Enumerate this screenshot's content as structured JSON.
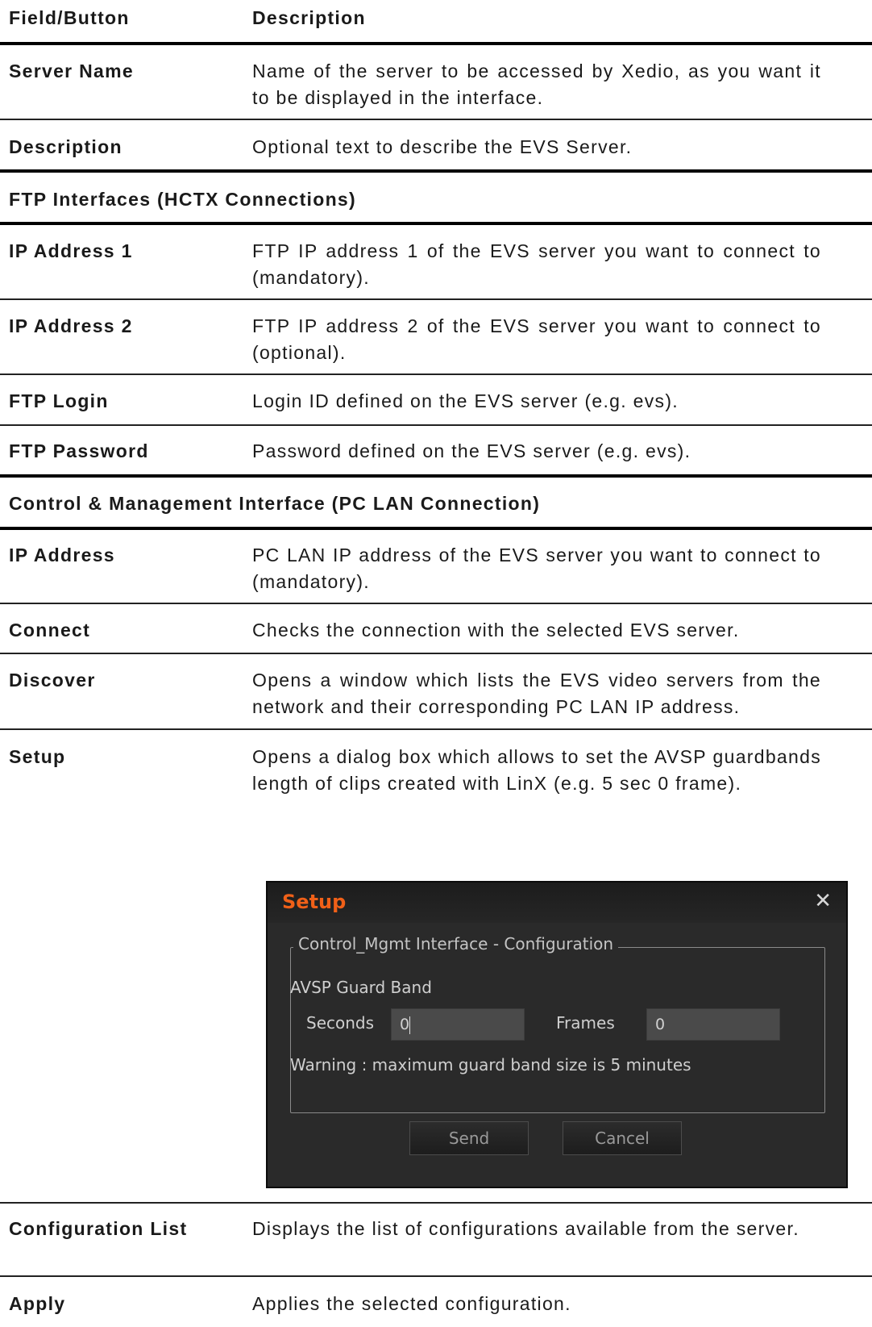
{
  "header": {
    "col1": "Field/Button",
    "col2": "Description"
  },
  "rows": [
    {
      "field": "Server Name",
      "description": "Name of the server to be accessed by Xedio, as you want it to be displayed in the interface."
    },
    {
      "field": "Description",
      "description": "Optional text to describe the EVS Server."
    }
  ],
  "section_ftp": "FTP Interfaces (HCTX Connections)",
  "ftp_rows": [
    {
      "field": "IP Address 1",
      "description": "FTP IP address 1 of the EVS server you want to connect to (mandatory)."
    },
    {
      "field": "IP Address 2",
      "description": "FTP IP address 2 of the EVS server you want to connect to (optional)."
    },
    {
      "field": "FTP Login",
      "description": "Login ID defined on the EVS server (e.g. evs)."
    },
    {
      "field": "FTP Password",
      "description": "Password defined on the EVS server (e.g. evs)."
    }
  ],
  "section_control": "Control & Management Interface (PC LAN Connection)",
  "control_rows": [
    {
      "field": "IP Address",
      "description": "PC LAN IP address of the EVS server you want to connect to (mandatory)."
    },
    {
      "field": "Connect",
      "description": "Checks the connection with the selected EVS server."
    },
    {
      "field": "Discover",
      "description": "Opens a window which lists the EVS video servers from the network and their corresponding PC LAN IP address."
    },
    {
      "field": "Setup",
      "description": "Opens a dialog box which allows to set the AVSP guardbands length of clips created with LinX (e.g. 5 sec 0 frame)."
    },
    {
      "field": "Configuration List",
      "description": "Displays the list of configurations available from the server."
    },
    {
      "field": "Apply",
      "description": "Applies the selected configuration."
    }
  ],
  "dialog": {
    "title": "Setup",
    "close_icon": "close-icon",
    "group_title": "Control_Mgmt Interface - Configuration",
    "guard_band_label": "AVSP Guard Band",
    "seconds_label": "Seconds",
    "seconds_value": "0",
    "frames_label": "Frames",
    "frames_value": "0",
    "warning": "Warning : maximum guard band size is 5 minutes",
    "send_label": "Send",
    "cancel_label": "Cancel",
    "colors": {
      "title": "#f06018",
      "background": "#2a2a2a",
      "input": "#4a4a4a"
    }
  }
}
